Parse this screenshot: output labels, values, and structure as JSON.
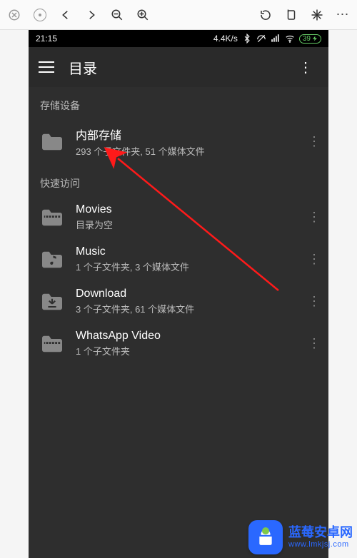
{
  "toolbar": {
    "close": "close",
    "home": "home",
    "back": "back",
    "forward": "forward",
    "zoom_out": "zoom-out",
    "zoom_in": "zoom-in",
    "rotate": "rotate",
    "unknown1": "adjust",
    "unknown2": "sparkle",
    "overflow": "…"
  },
  "statusbar": {
    "time": "21:15",
    "net_speed": "4.4K/s",
    "battery": "39"
  },
  "header": {
    "title": "目录"
  },
  "sections": {
    "storage_label": "存储设备",
    "quick_label": "快速访问"
  },
  "items": {
    "internal": {
      "title": "内部存储",
      "subtitle": "293 个子文件夹, 51 个媒体文件"
    },
    "movies": {
      "title": "Movies",
      "subtitle": "目录为空"
    },
    "music": {
      "title": "Music",
      "subtitle": "1 个子文件夹, 3 个媒体文件"
    },
    "download": {
      "title": "Download",
      "subtitle": "3 个子文件夹, 61 个媒体文件"
    },
    "whatsapp": {
      "title": "WhatsApp Video",
      "subtitle": "1 个子文件夹"
    }
  },
  "watermark": {
    "name": "蓝莓安卓网",
    "url": "www.lmkjsj.com"
  }
}
